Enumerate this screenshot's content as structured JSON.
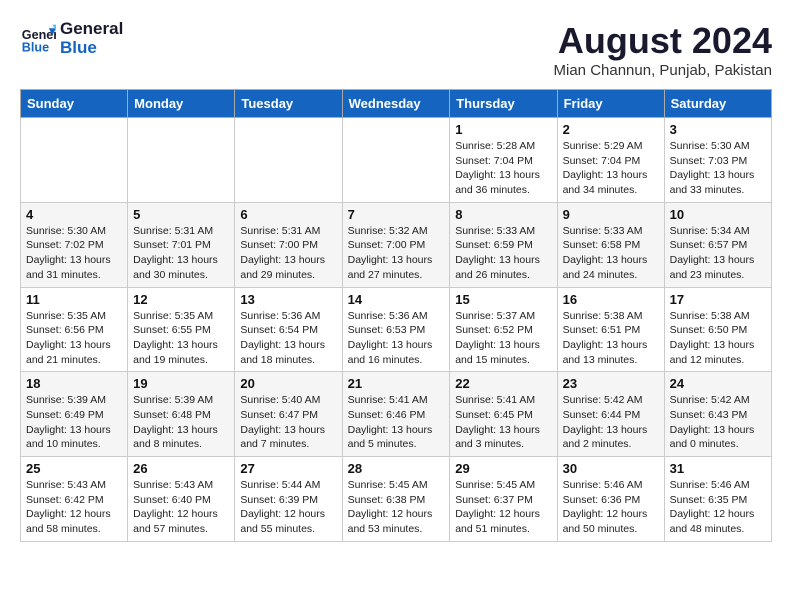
{
  "logo": {
    "line1": "General",
    "line2": "Blue"
  },
  "title": {
    "month_year": "August 2024",
    "location": "Mian Channun, Punjab, Pakistan"
  },
  "weekdays": [
    "Sunday",
    "Monday",
    "Tuesday",
    "Wednesday",
    "Thursday",
    "Friday",
    "Saturday"
  ],
  "weeks": [
    [
      {
        "day": "",
        "info": ""
      },
      {
        "day": "",
        "info": ""
      },
      {
        "day": "",
        "info": ""
      },
      {
        "day": "",
        "info": ""
      },
      {
        "day": "1",
        "info": "Sunrise: 5:28 AM\nSunset: 7:04 PM\nDaylight: 13 hours and 36 minutes."
      },
      {
        "day": "2",
        "info": "Sunrise: 5:29 AM\nSunset: 7:04 PM\nDaylight: 13 hours and 34 minutes."
      },
      {
        "day": "3",
        "info": "Sunrise: 5:30 AM\nSunset: 7:03 PM\nDaylight: 13 hours and 33 minutes."
      }
    ],
    [
      {
        "day": "4",
        "info": "Sunrise: 5:30 AM\nSunset: 7:02 PM\nDaylight: 13 hours and 31 minutes."
      },
      {
        "day": "5",
        "info": "Sunrise: 5:31 AM\nSunset: 7:01 PM\nDaylight: 13 hours and 30 minutes."
      },
      {
        "day": "6",
        "info": "Sunrise: 5:31 AM\nSunset: 7:00 PM\nDaylight: 13 hours and 29 minutes."
      },
      {
        "day": "7",
        "info": "Sunrise: 5:32 AM\nSunset: 7:00 PM\nDaylight: 13 hours and 27 minutes."
      },
      {
        "day": "8",
        "info": "Sunrise: 5:33 AM\nSunset: 6:59 PM\nDaylight: 13 hours and 26 minutes."
      },
      {
        "day": "9",
        "info": "Sunrise: 5:33 AM\nSunset: 6:58 PM\nDaylight: 13 hours and 24 minutes."
      },
      {
        "day": "10",
        "info": "Sunrise: 5:34 AM\nSunset: 6:57 PM\nDaylight: 13 hours and 23 minutes."
      }
    ],
    [
      {
        "day": "11",
        "info": "Sunrise: 5:35 AM\nSunset: 6:56 PM\nDaylight: 13 hours and 21 minutes."
      },
      {
        "day": "12",
        "info": "Sunrise: 5:35 AM\nSunset: 6:55 PM\nDaylight: 13 hours and 19 minutes."
      },
      {
        "day": "13",
        "info": "Sunrise: 5:36 AM\nSunset: 6:54 PM\nDaylight: 13 hours and 18 minutes."
      },
      {
        "day": "14",
        "info": "Sunrise: 5:36 AM\nSunset: 6:53 PM\nDaylight: 13 hours and 16 minutes."
      },
      {
        "day": "15",
        "info": "Sunrise: 5:37 AM\nSunset: 6:52 PM\nDaylight: 13 hours and 15 minutes."
      },
      {
        "day": "16",
        "info": "Sunrise: 5:38 AM\nSunset: 6:51 PM\nDaylight: 13 hours and 13 minutes."
      },
      {
        "day": "17",
        "info": "Sunrise: 5:38 AM\nSunset: 6:50 PM\nDaylight: 13 hours and 12 minutes."
      }
    ],
    [
      {
        "day": "18",
        "info": "Sunrise: 5:39 AM\nSunset: 6:49 PM\nDaylight: 13 hours and 10 minutes."
      },
      {
        "day": "19",
        "info": "Sunrise: 5:39 AM\nSunset: 6:48 PM\nDaylight: 13 hours and 8 minutes."
      },
      {
        "day": "20",
        "info": "Sunrise: 5:40 AM\nSunset: 6:47 PM\nDaylight: 13 hours and 7 minutes."
      },
      {
        "day": "21",
        "info": "Sunrise: 5:41 AM\nSunset: 6:46 PM\nDaylight: 13 hours and 5 minutes."
      },
      {
        "day": "22",
        "info": "Sunrise: 5:41 AM\nSunset: 6:45 PM\nDaylight: 13 hours and 3 minutes."
      },
      {
        "day": "23",
        "info": "Sunrise: 5:42 AM\nSunset: 6:44 PM\nDaylight: 13 hours and 2 minutes."
      },
      {
        "day": "24",
        "info": "Sunrise: 5:42 AM\nSunset: 6:43 PM\nDaylight: 13 hours and 0 minutes."
      }
    ],
    [
      {
        "day": "25",
        "info": "Sunrise: 5:43 AM\nSunset: 6:42 PM\nDaylight: 12 hours and 58 minutes."
      },
      {
        "day": "26",
        "info": "Sunrise: 5:43 AM\nSunset: 6:40 PM\nDaylight: 12 hours and 57 minutes."
      },
      {
        "day": "27",
        "info": "Sunrise: 5:44 AM\nSunset: 6:39 PM\nDaylight: 12 hours and 55 minutes."
      },
      {
        "day": "28",
        "info": "Sunrise: 5:45 AM\nSunset: 6:38 PM\nDaylight: 12 hours and 53 minutes."
      },
      {
        "day": "29",
        "info": "Sunrise: 5:45 AM\nSunset: 6:37 PM\nDaylight: 12 hours and 51 minutes."
      },
      {
        "day": "30",
        "info": "Sunrise: 5:46 AM\nSunset: 6:36 PM\nDaylight: 12 hours and 50 minutes."
      },
      {
        "day": "31",
        "info": "Sunrise: 5:46 AM\nSunset: 6:35 PM\nDaylight: 12 hours and 48 minutes."
      }
    ]
  ]
}
